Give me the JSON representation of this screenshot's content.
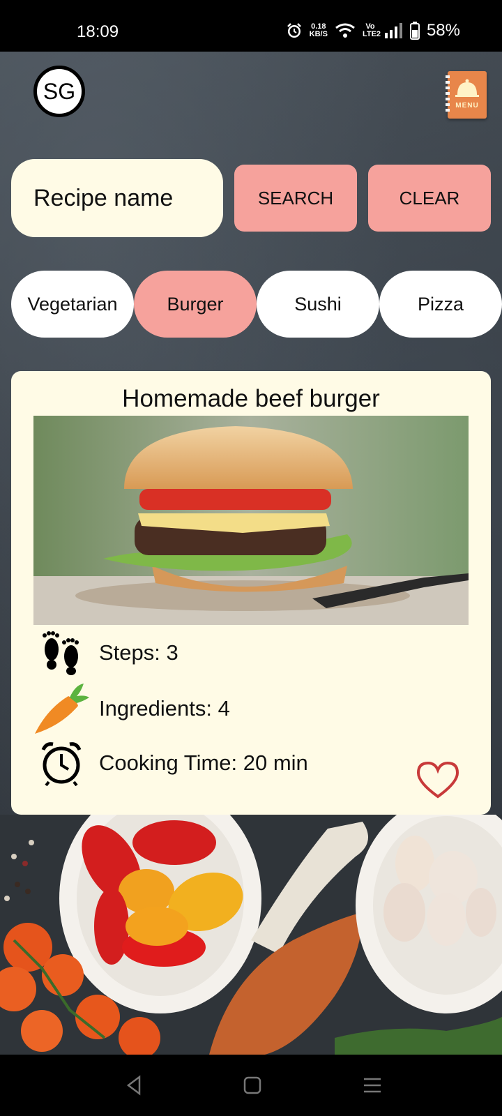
{
  "status_bar": {
    "time": "18:09",
    "net_speed_value": "0.18",
    "net_speed_unit": "KB/S",
    "volte": "Vo LTE2",
    "battery": "58%"
  },
  "header": {
    "avatar_initials": "SG",
    "menu_icon_label": "MENU"
  },
  "search": {
    "placeholder": "Recipe name",
    "search_label": "SEARCH",
    "clear_label": "CLEAR"
  },
  "categories": [
    {
      "label": "Vegetarian",
      "active": false
    },
    {
      "label": "Burger",
      "active": true
    },
    {
      "label": "Sushi",
      "active": false
    },
    {
      "label": "Pizza",
      "active": false
    }
  ],
  "recipe": {
    "title": "Homemade beef burger",
    "steps": "Steps: 3",
    "ingredients": "Ingredients: 4",
    "cooking_time": "Cooking Time: 20 min",
    "favorite": false
  },
  "colors": {
    "accent_pink": "#f6a29c",
    "card_cream": "#fffbe6",
    "heart_red": "#c83a3a"
  },
  "icons": [
    "alarm-icon",
    "wifi-icon",
    "signal-icon",
    "battery-icon",
    "menu-book-icon",
    "footprints-icon",
    "carrot-icon",
    "alarm-clock-icon",
    "heart-outline-icon",
    "back-nav-icon",
    "home-nav-icon",
    "recents-nav-icon"
  ]
}
